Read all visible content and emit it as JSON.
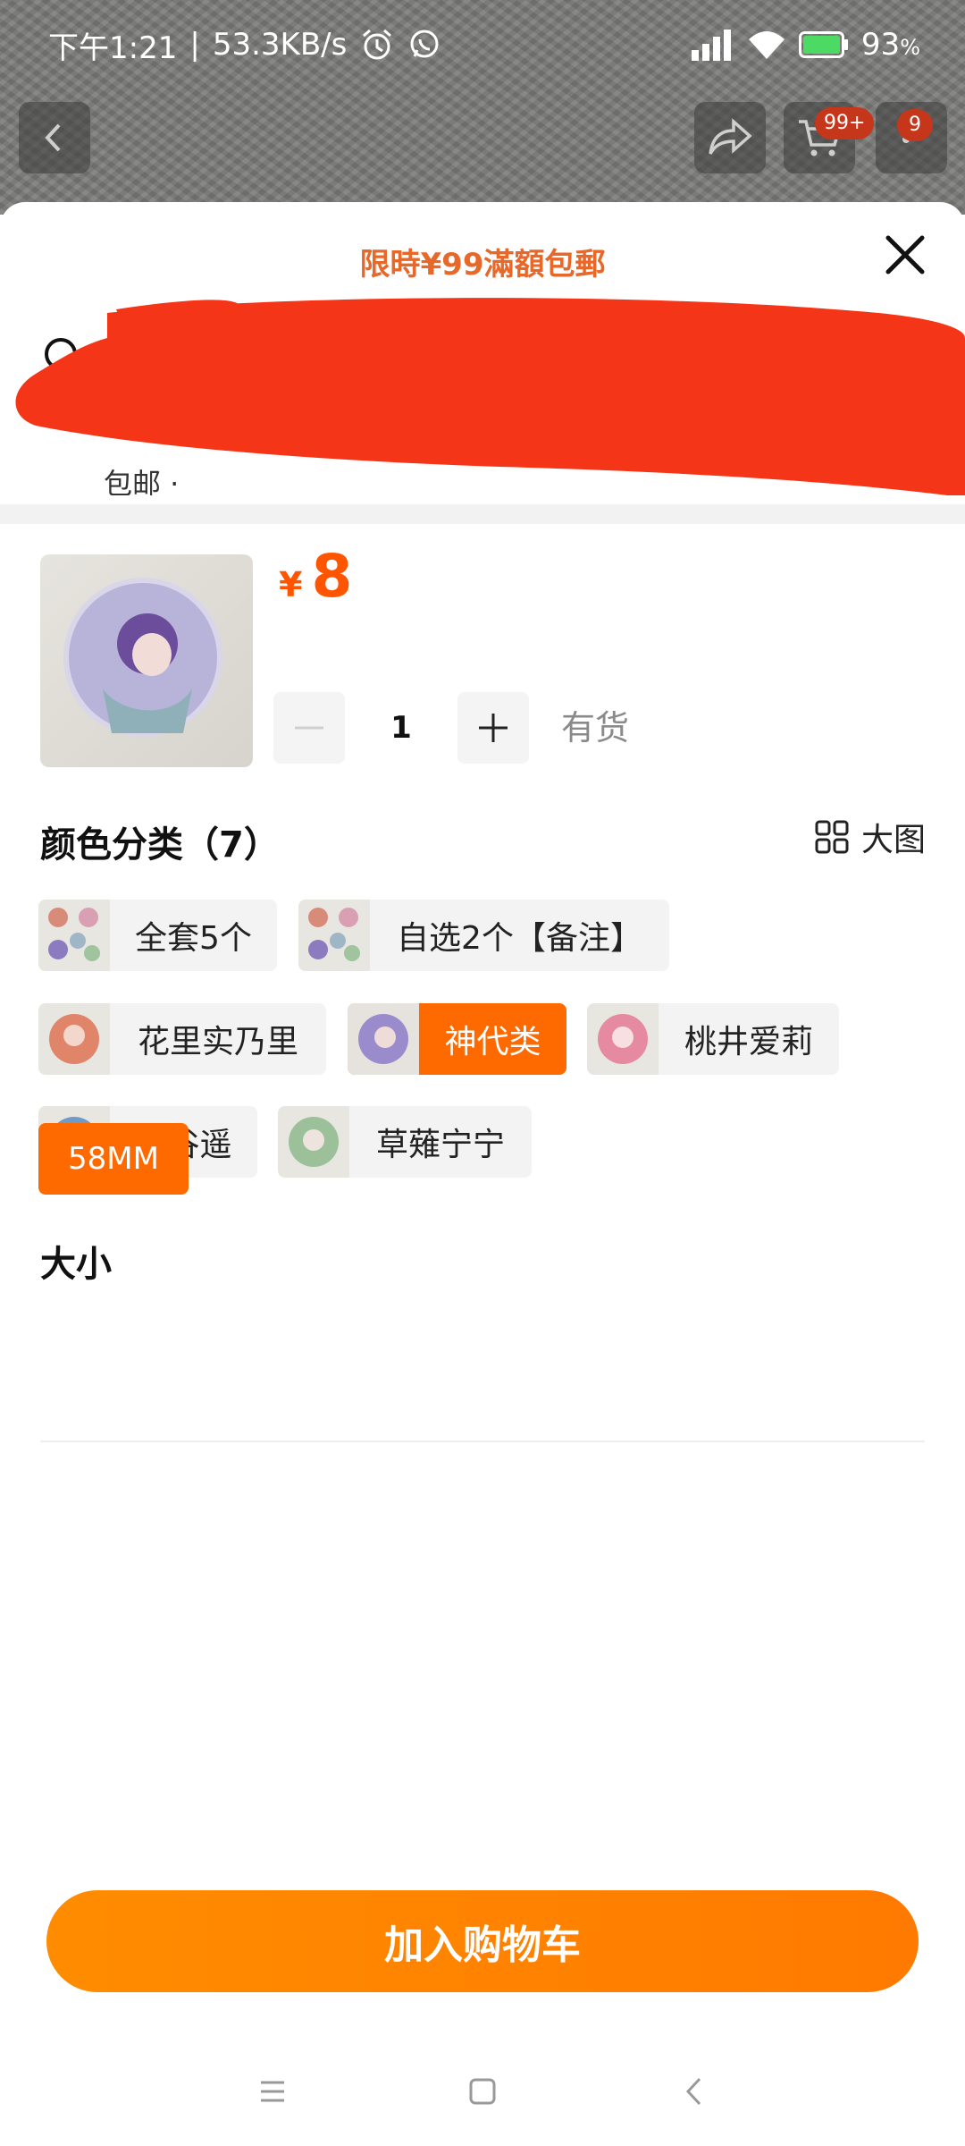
{
  "status_bar": {
    "time": "下午1:21",
    "separator": "|",
    "net_speed": "53.3KB/s",
    "battery": "93",
    "battery_unit": "%"
  },
  "top_nav": {
    "cart_badge": "99+",
    "more_badge": "9"
  },
  "sheet": {
    "promo": "限時¥99滿額包郵",
    "address_partial": "包邮 ·"
  },
  "product": {
    "currency": "¥",
    "price": "8",
    "quantity": "1",
    "stock_status": "有货"
  },
  "color_section": {
    "title": "颜色分类（7）",
    "big_image_label": "大图",
    "options": [
      {
        "label": "全套5个",
        "selected": false
      },
      {
        "label": "自选2个【备注】",
        "selected": false
      },
      {
        "label": "花里实乃里",
        "selected": false
      },
      {
        "label": "神代类",
        "selected": true
      },
      {
        "label": "桃井爱莉",
        "selected": false
      },
      {
        "label": "桐谷遥",
        "selected": false
      },
      {
        "label": "草薙宁宁",
        "selected": false
      }
    ]
  },
  "size_section": {
    "title": "大小",
    "options": [
      {
        "label": "58MM",
        "selected": true
      }
    ]
  },
  "actions": {
    "add_to_cart": "加入购物车"
  },
  "colors": {
    "accent": "#ff6a00",
    "price": "#ff5500",
    "promo": "#e8682a",
    "redaction": "#f53517"
  }
}
